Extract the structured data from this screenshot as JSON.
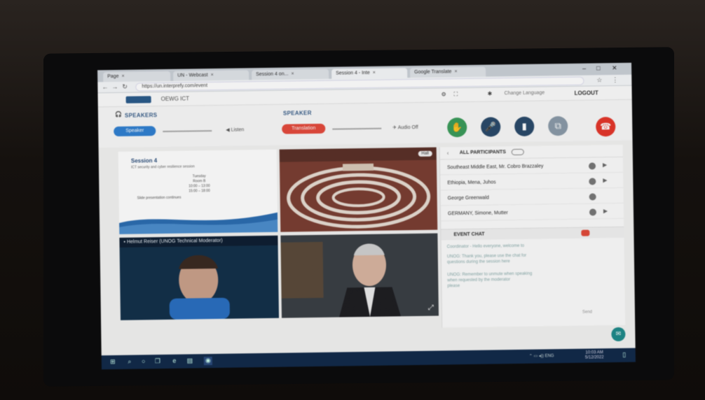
{
  "browser": {
    "tabs": [
      {
        "label": "Page",
        "active": false
      },
      {
        "label": "UN - Webcast",
        "active": false
      },
      {
        "label": "Session 4 on...",
        "active": false
      },
      {
        "label": "Session 4 - Inte",
        "active": true
      },
      {
        "label": "Google Translate",
        "active": false
      }
    ],
    "url": "https://un.interprefy.com/event",
    "window_controls": [
      "–",
      "□",
      "✕"
    ]
  },
  "app": {
    "event_title": "OEWG ICT",
    "header_extra": "Change Language",
    "logout_label": "LOGOUT"
  },
  "controls": {
    "speakers_label": "SPEAKERS",
    "speakers_pill": "Speaker",
    "listen_label": "Listen",
    "speech_label": "SPEAKER",
    "speech_pill": "Translation",
    "mute_label": "Audio Off",
    "colors": {
      "blue": "#2f7fd0",
      "red": "#e34a3c",
      "green": "#3b9b5a",
      "navy": "#2a4a6a",
      "hangup": "#e3362a"
    }
  },
  "slide": {
    "title": "Session 4",
    "subtitle": "ICT security and cyber resilience session",
    "lines": [
      "Tuesday",
      "Room B",
      "10:00 – 13:00",
      "15:00 – 18:00"
    ],
    "bullet": "Slide presentation continues",
    "accent": "#2b6cb0"
  },
  "hall": {
    "button_label": "Hall"
  },
  "videos": [
    {
      "name": "Helmut Reiser (UNOG Technical Moderator)"
    },
    {
      "name": ""
    }
  ],
  "panel": {
    "title": "ALL PARTICIPANTS",
    "participants": [
      "Southeast Middle East, Mr. Cobro Brazzaley",
      "Ethiopia, Mena, Juhos",
      "George Greenwald",
      "GERMANY, Simone, Mutter"
    ],
    "chat_title": "EVENT CHAT",
    "chat_lines": [
      "Coordinator - Hello everyone, welcome to",
      "UNOG: Thank you, please use the chat for",
      "questions during the session here",
      "UNOG: Remember to unmute when speaking",
      "when requested by the moderator",
      "please"
    ],
    "send_label": "Send"
  },
  "taskbar": {
    "time": "10:03 AM",
    "date": "5/12/2022",
    "tray": "ENG"
  }
}
